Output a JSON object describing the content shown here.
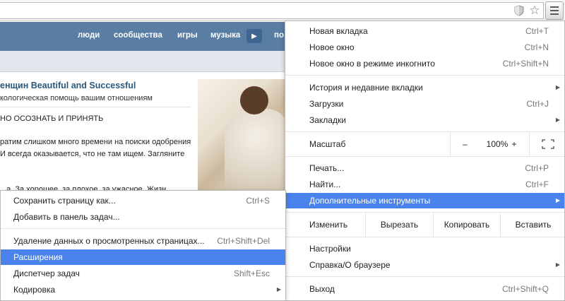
{
  "toolbar": {
    "shield_icon": "shield-icon",
    "star_icon": "star-icon",
    "menu_icon": "hamburger-menu-icon"
  },
  "vk": {
    "nav": [
      "люди",
      "сообщества",
      "игры",
      "музыка",
      "по"
    ],
    "post": {
      "title": "енщин Beautiful and Successful",
      "subtitle": "кологическая помощь вашим отношениям",
      "lines": [
        "НО ОСОЗНАТЬ И ПРИНЯТЬ",
        "ратим слишком много времени на поиски одобрения",
        "И всегда оказывается, что не там ищем. Загляните",
        "...а. За хорошее, за плохое, за ужасное. Жизн"
      ]
    }
  },
  "main_menu": {
    "items_top": [
      {
        "label": "Новая вкладка",
        "shortcut": "Ctrl+T"
      },
      {
        "label": "Новое окно",
        "shortcut": "Ctrl+N"
      },
      {
        "label": "Новое окно в режиме инкогнито",
        "shortcut": "Ctrl+Shift+N"
      }
    ],
    "items_mid": [
      {
        "label": "История и недавние вкладки",
        "shortcut": ""
      },
      {
        "label": "Загрузки",
        "shortcut": "Ctrl+J"
      },
      {
        "label": "Закладки",
        "shortcut": ""
      }
    ],
    "zoom": {
      "label": "Масштаб",
      "minus": "–",
      "value": "100%",
      "plus": "+"
    },
    "items_tools": [
      {
        "label": "Печать...",
        "shortcut": "Ctrl+P"
      },
      {
        "label": "Найти...",
        "shortcut": "Ctrl+F"
      },
      {
        "label": "Дополнительные инструменты",
        "shortcut": ""
      }
    ],
    "edit": {
      "label": "Изменить",
      "cut": "Вырезать",
      "copy": "Копировать",
      "paste": "Вставить"
    },
    "items_bottom": [
      {
        "label": "Настройки",
        "shortcut": ""
      },
      {
        "label": "Справка/О браузере",
        "shortcut": ""
      }
    ],
    "exit": {
      "label": "Выход",
      "shortcut": "Ctrl+Shift+Q"
    }
  },
  "sub_menu": {
    "items": [
      {
        "label": "Сохранить страницу как...",
        "shortcut": "Ctrl+S"
      },
      {
        "label": "Добавить в панель задач...",
        "shortcut": ""
      },
      {
        "label": "Удаление данных о просмотренных страницах...",
        "shortcut": "Ctrl+Shift+Del"
      },
      {
        "label": "Расширения",
        "shortcut": ""
      },
      {
        "label": "Диспетчер задач",
        "shortcut": "Shift+Esc"
      },
      {
        "label": "Кодировка",
        "shortcut": ""
      }
    ]
  },
  "colors": {
    "highlight": "#4a83ec",
    "vk_header": "#597da3"
  }
}
